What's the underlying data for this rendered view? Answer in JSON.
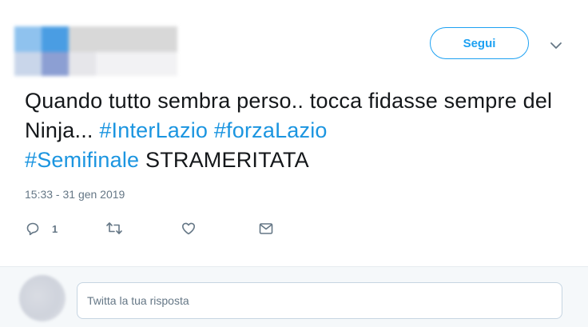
{
  "follow": {
    "label": "Segui"
  },
  "tweet": {
    "segments": [
      {
        "text": "Quando tutto sembra perso.. tocca fidasse sempre del Ninja... ",
        "hashtag": false
      },
      {
        "text": "#InterLazio",
        "hashtag": true
      },
      {
        "text": " ",
        "hashtag": false
      },
      {
        "text": "#forzaLazio",
        "hashtag": true
      },
      {
        "text": " ",
        "hashtag": false
      },
      {
        "text": "#Semifinale",
        "hashtag": true
      },
      {
        "text": " STRAMERITATA",
        "hashtag": false
      }
    ],
    "timestamp": "15:33 - 31 gen 2019"
  },
  "actions": {
    "reply_count": "1",
    "icons": [
      "reply-icon",
      "retweet-icon",
      "like-icon",
      "direct-message-icon"
    ]
  },
  "reply_box": {
    "placeholder": "Twitta la tua risposta"
  },
  "colors": {
    "accent": "#1da1f2",
    "hashtag": "#1b95e0",
    "muted": "#657786",
    "text": "#14171a"
  }
}
